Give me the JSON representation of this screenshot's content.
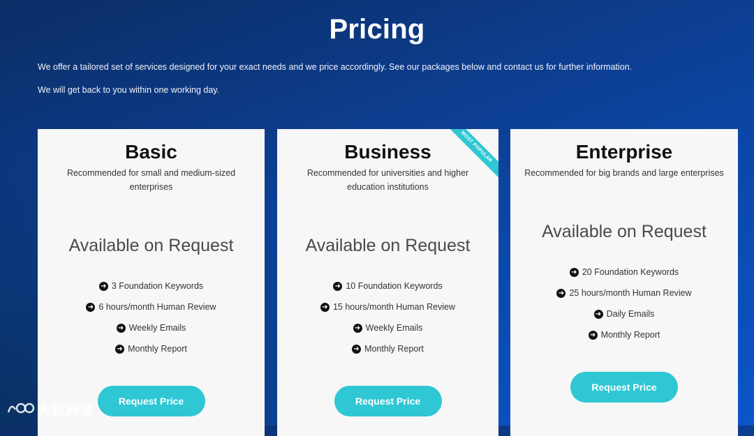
{
  "page": {
    "title": "Pricing",
    "intro_lines": [
      "We offer a tailored set of services designed for your exact needs and we price accordingly. See our packages below and contact us for further information.",
      "We will get back to you within one working day."
    ]
  },
  "plans": [
    {
      "name": "Basic",
      "description": "Recommended for small and medium-sized enterprises",
      "price": "Available on Request",
      "features": [
        "3 Foundation Keywords",
        "6 hours/month Human Review",
        "Weekly Emails",
        "Monthly Report"
      ],
      "button": "Request Price"
    },
    {
      "name": "Business",
      "description": "Recommended for universities and higher education institutions",
      "price": "Available on Request",
      "features": [
        "10 Foundation Keywords",
        "15 hours/month Human Review",
        "Weekly Emails",
        "Monthly Report"
      ],
      "button": "Request Price",
      "badge": "MOST POPULAR"
    },
    {
      "name": "Enterprise",
      "description": "Recommended for big brands and large enterprises",
      "price": "Available on Request",
      "features": [
        "20 Foundation Keywords",
        "25 hours/month Human Review",
        "Daily Emails",
        "Monthly Report"
      ],
      "button": "Request Price"
    }
  ],
  "watermark": {
    "text": "大数跨境",
    "icon": "logo-mark-icon"
  },
  "colors": {
    "accent": "#2ec7d3",
    "background": "#0b47a8",
    "card": "#f7f7f7"
  },
  "icons": {
    "feature_bullet": "arrow-circle-right-icon"
  }
}
